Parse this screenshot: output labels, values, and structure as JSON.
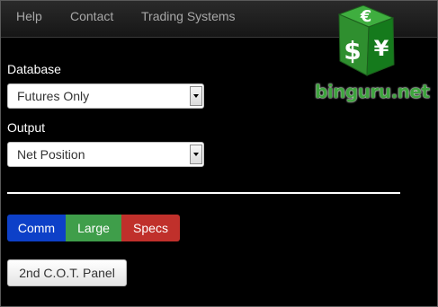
{
  "navbar": {
    "items": [
      {
        "label": "Help"
      },
      {
        "label": "Contact"
      },
      {
        "label": "Trading Systems"
      }
    ]
  },
  "form": {
    "database": {
      "label": "Database",
      "value": "Futures Only"
    },
    "output": {
      "label": "Output",
      "value": "Net Position"
    }
  },
  "segments": [
    {
      "label": "Comm",
      "color": "#0d40c8"
    },
    {
      "label": "Large",
      "color": "#3f9e4a"
    },
    {
      "label": "Specs",
      "color": "#c0302b"
    }
  ],
  "second_panel_button": {
    "label": "2nd C.O.T. Panel"
  },
  "logo": {
    "text": "binguru.net",
    "symbols": [
      "€",
      "$",
      "¥"
    ],
    "color": "#3ea33e"
  }
}
